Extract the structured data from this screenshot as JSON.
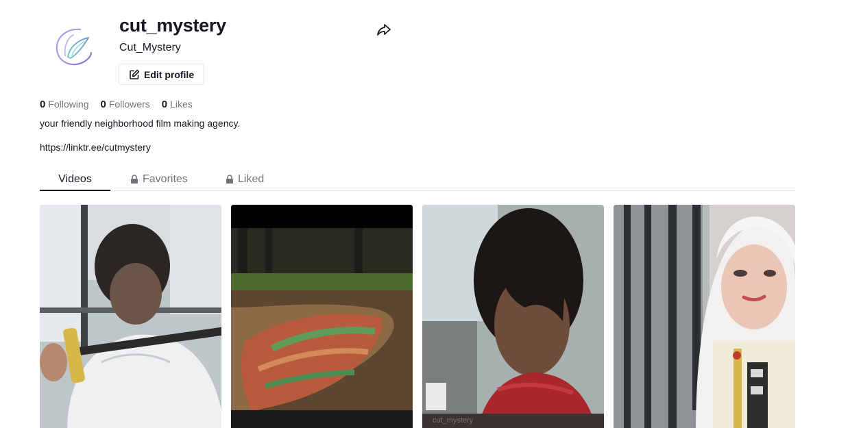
{
  "profile": {
    "username": "cut_mystery",
    "nickname": "Cut_Mystery",
    "edit_label": "Edit profile",
    "bio": "your friendly neighborhood film making agency.",
    "link": "https://linktr.ee/cutmystery"
  },
  "stats": [
    {
      "value": "0",
      "label": "Following"
    },
    {
      "value": "0",
      "label": "Followers"
    },
    {
      "value": "0",
      "label": "Likes"
    }
  ],
  "tabs": [
    {
      "label": "Videos",
      "locked": false,
      "active": true
    },
    {
      "label": "Favorites",
      "locked": true,
      "active": false
    },
    {
      "label": "Liked",
      "locked": true,
      "active": false
    }
  ],
  "videos": [
    {
      "description": "man in white shirt holding katana by window"
    },
    {
      "description": "colorful fabric on ground in park"
    },
    {
      "description": "person with dark hair and red scarf"
    },
    {
      "description": "cosplayer with white hair near fence"
    }
  ],
  "icons": {
    "share": "share-arrow-icon",
    "edit": "edit-pencil-icon",
    "lock": "lock-icon"
  }
}
